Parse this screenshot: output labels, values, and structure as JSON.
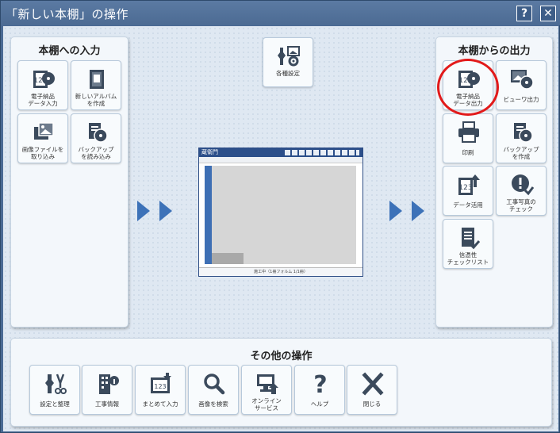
{
  "window": {
    "title": "「新しい本棚」の操作",
    "help_label": "?",
    "close_label": "✕"
  },
  "left_panel": {
    "title": "本棚への入力",
    "tiles": [
      {
        "label": "電子納品\nデータ入力",
        "icon": "data-input-icon"
      },
      {
        "label": "新しいアルバム\nを作成",
        "icon": "album-icon"
      },
      {
        "label": "画像ファイルを\n取り込み",
        "icon": "image-import-icon"
      },
      {
        "label": "バックアップ\nを読み込み",
        "icon": "backup-load-icon"
      }
    ]
  },
  "center": {
    "settings_label": "各種設定"
  },
  "right_panel": {
    "title": "本棚からの出力",
    "tiles": [
      {
        "label": "電子納品\nデータ出力",
        "icon": "data-output-icon"
      },
      {
        "label": "ビューワ出力",
        "icon": "viewer-output-icon"
      },
      {
        "label": "印刷",
        "icon": "printer-icon"
      },
      {
        "label": "バックアップ\nを作成",
        "icon": "backup-create-icon"
      },
      {
        "label": "データ活用",
        "icon": "data-use-icon"
      },
      {
        "label": "工事写真の\nチェック",
        "icon": "photo-check-icon"
      },
      {
        "label": "信憑性\nチェックリスト",
        "icon": "checklist-icon"
      }
    ]
  },
  "bottom_panel": {
    "title": "その他の操作",
    "tiles": [
      {
        "label": "設定と整理",
        "icon": "tools-icon"
      },
      {
        "label": "工事情報",
        "icon": "building-info-icon"
      },
      {
        "label": "まとめて入力",
        "icon": "bulk-input-icon"
      },
      {
        "label": "画像を検索",
        "icon": "search-icon"
      },
      {
        "label": "オンライン\nサービス",
        "icon": "online-service-icon"
      },
      {
        "label": "ヘルプ",
        "icon": "help-icon"
      },
      {
        "label": "閉じる",
        "icon": "close-icon"
      }
    ]
  },
  "preview": {
    "app_name": "蔵衛門",
    "status_text": "施工中（1冊フォルム 1/1冊）"
  },
  "colors": {
    "accent": "#3d72b8",
    "highlight": "#e21a1a",
    "titlebar": "#4f6f98"
  }
}
